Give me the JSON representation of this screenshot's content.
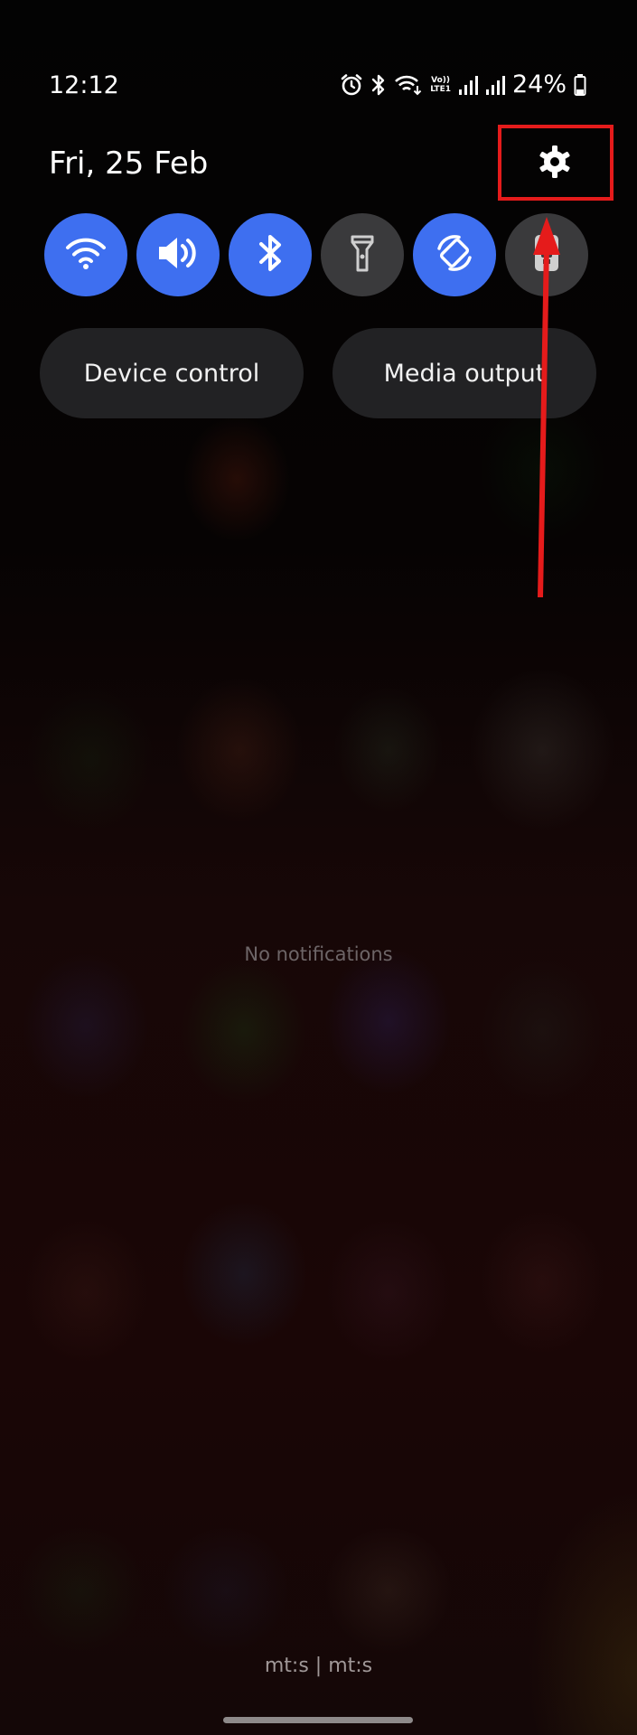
{
  "status_bar": {
    "time": "12:12",
    "battery_percent": "24%",
    "volte_top": "Vo))",
    "volte_bottom": "LTE1",
    "icons": [
      "alarm-icon",
      "bluetooth-icon",
      "wifi-calling-icon",
      "signal-icon",
      "signal-icon",
      "battery-icon"
    ]
  },
  "header": {
    "date": "Fri, 25 Feb",
    "settings_icon": "gear-icon"
  },
  "quick_toggles": [
    {
      "name": "wifi",
      "icon": "wifi-icon",
      "on": true
    },
    {
      "name": "sound",
      "icon": "speaker-icon",
      "on": true
    },
    {
      "name": "bluetooth",
      "icon": "bluetooth-icon",
      "on": true
    },
    {
      "name": "flashlight",
      "icon": "flashlight-icon",
      "on": false
    },
    {
      "name": "auto-rotate",
      "icon": "rotate-icon",
      "on": true
    },
    {
      "name": "dnd",
      "icon": "portrait-lock-icon",
      "on": false
    }
  ],
  "buttons": {
    "device_control": "Device control",
    "media_output": "Media output"
  },
  "notifications": {
    "empty_text": "No notifications"
  },
  "carrier": {
    "label": "mt:s | mt:s"
  },
  "colors": {
    "toggle_on": "#3e6ff0",
    "toggle_off": "#3a3a3c",
    "annotation_red": "#e51b1b"
  }
}
